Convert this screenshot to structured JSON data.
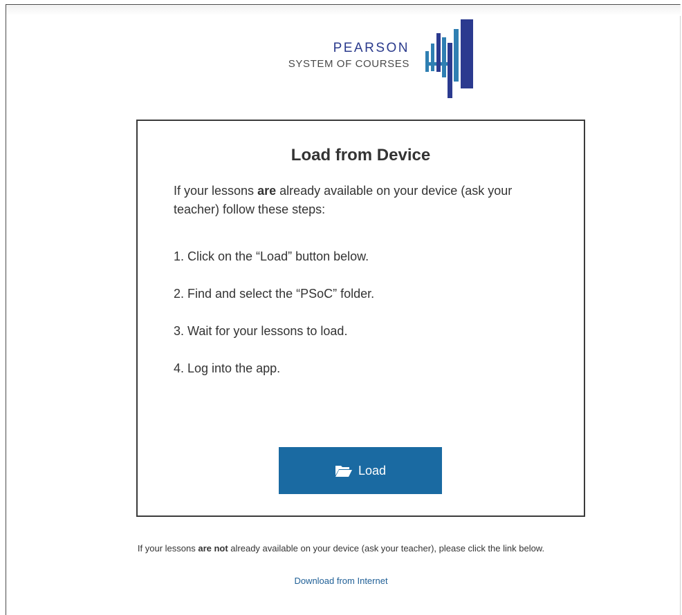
{
  "logo": {
    "word": "PEARSON",
    "subtitle": "SYSTEM OF COURSES",
    "icon": "pearson-bars-logo",
    "colors": {
      "navy": "#2b3a8f",
      "teal": "#2f7fb2"
    }
  },
  "card": {
    "title": "Load from Device",
    "intro": {
      "before": "If your lessons ",
      "emphasis": "are",
      "after": " already available on your device (ask your teacher) follow these steps:"
    },
    "steps": [
      "1. Click on the “Load” button below.",
      "2. Find and select the “PSoC” folder.",
      "3. Wait for your lessons to load.",
      "4. Log into the app."
    ],
    "load_button": {
      "label": "Load",
      "icon": "folder-open-icon",
      "color": "#1a6aa2"
    }
  },
  "footer": {
    "note_before": "If your lessons ",
    "note_emphasis": "are not",
    "note_after": " already available on your device (ask your teacher), please click the link below.",
    "link_label": "Download from Internet",
    "link_color": "#1f5f96"
  }
}
